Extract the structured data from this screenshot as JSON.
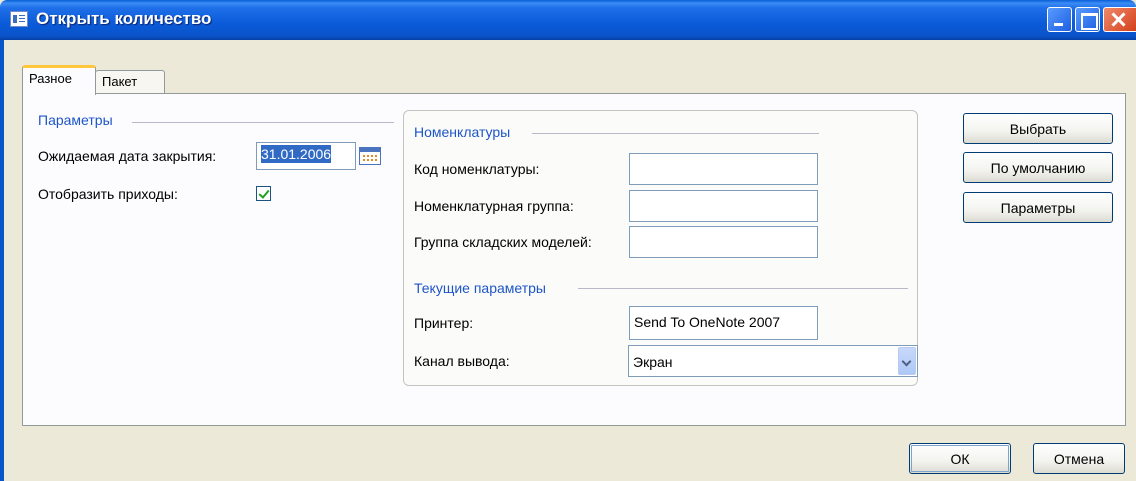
{
  "window": {
    "title": "Открыть количество"
  },
  "tabs": [
    {
      "label": "Разное",
      "active": true
    },
    {
      "label": "Пакет",
      "active": false
    }
  ],
  "params_section": {
    "title": "Параметры",
    "expected_close_date_label": "Ожидаемая дата закрытия:",
    "expected_close_date_value": "31.01.2006",
    "show_receipts_label": "Отобразить приходы:",
    "show_receipts_checked": true
  },
  "items_section": {
    "title": "Номенклатуры",
    "item_code_label": "Код номенклатуры:",
    "item_code_value": "",
    "item_group_label": "Номенклатурная группа:",
    "item_group_value": "",
    "storage_model_group_label": "Группа складских моделей:",
    "storage_model_group_value": ""
  },
  "current_params_section": {
    "title": "Текущие параметры",
    "printer_label": "Принтер:",
    "printer_value": "Send To OneNote 2007",
    "output_channel_label": "Канал вывода:",
    "output_channel_value": "Экран"
  },
  "side_buttons": {
    "select": "Выбрать",
    "default": "По умолчанию",
    "parameters": "Параметры"
  },
  "footer_buttons": {
    "ok": "ОК",
    "cancel": "Отмена"
  },
  "colors": {
    "titlebar": "#0a54c9",
    "section_title": "#1e56c8",
    "tab_highlight": "#ffc83c",
    "selection": "#316ac5"
  }
}
